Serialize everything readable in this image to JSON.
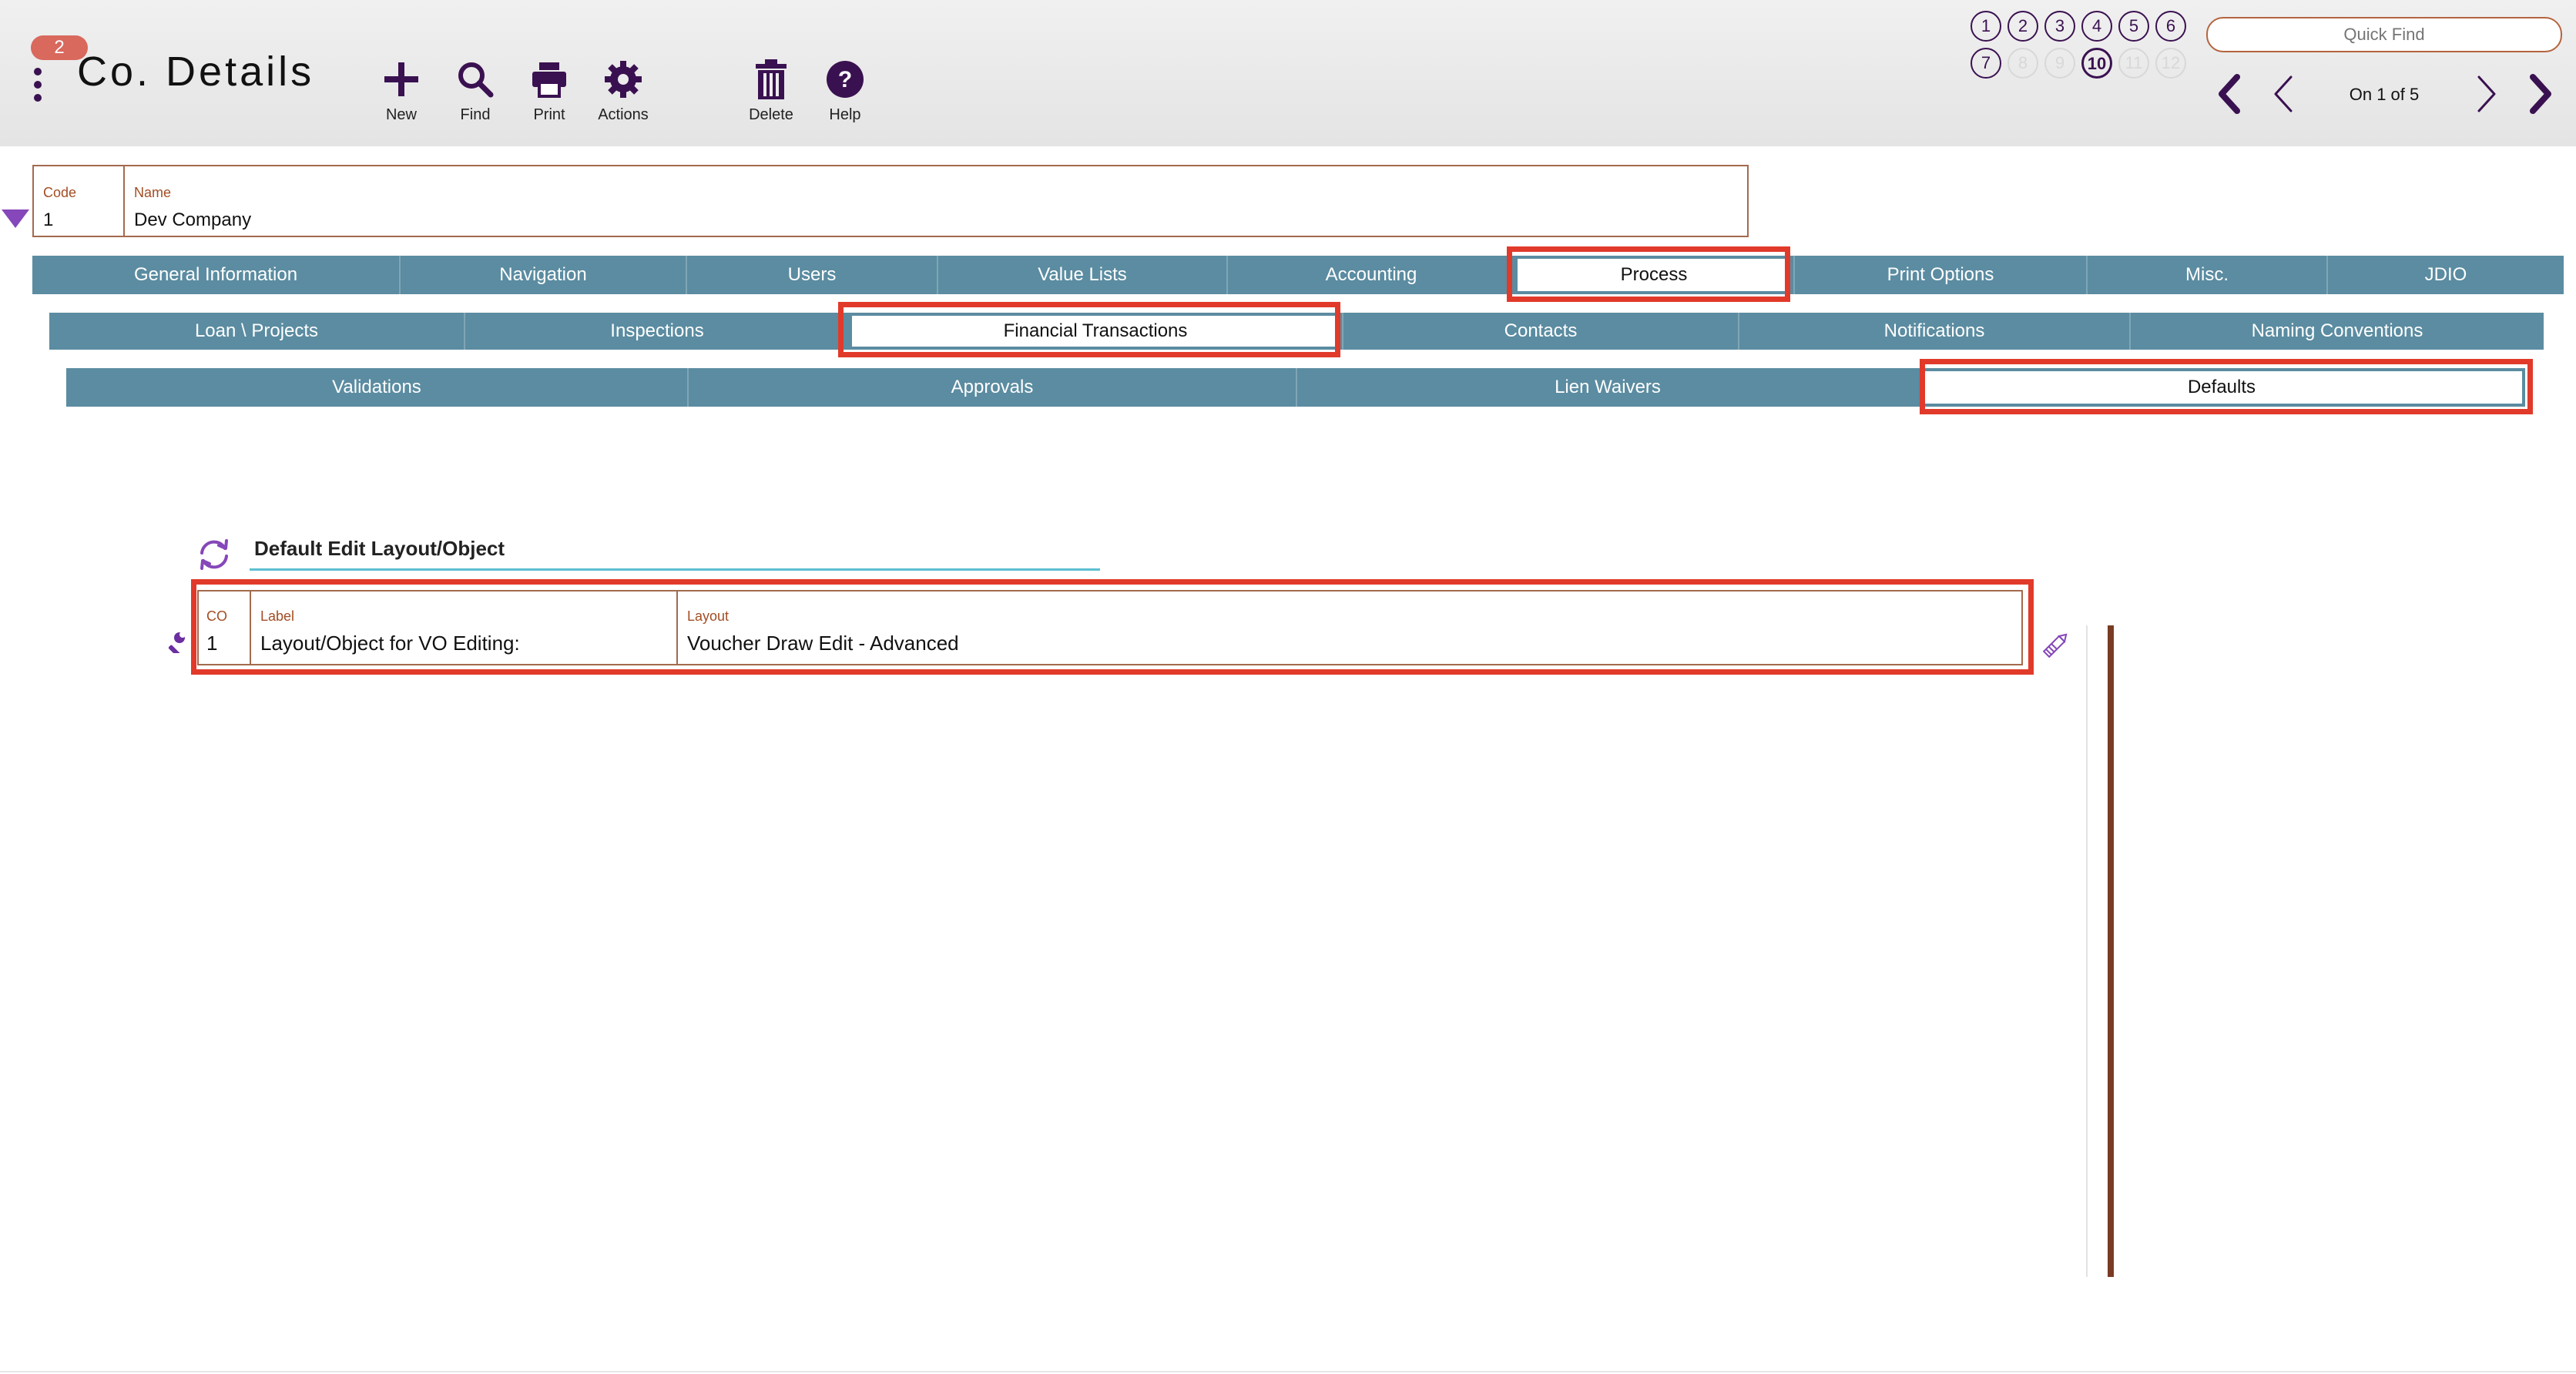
{
  "header": {
    "badge_count": "2",
    "title": "Co. Details",
    "toolbar": {
      "new_label": "New",
      "find_label": "Find",
      "print_label": "Print",
      "actions_label": "Actions",
      "delete_label": "Delete",
      "help_label": "Help"
    },
    "layout_numbers": [
      "1",
      "2",
      "3",
      "4",
      "5",
      "6",
      "7",
      "8",
      "9",
      "10",
      "11",
      "12"
    ],
    "current_layout": "10",
    "disabled_layouts": [
      "8",
      "9",
      "11",
      "12"
    ],
    "quick_find_placeholder": "Quick Find",
    "record_position": "On 1 of 5"
  },
  "record": {
    "code_caption": "Code",
    "code_value": "1",
    "name_caption": "Name",
    "name_value": "Dev Company"
  },
  "tabs_level1": {
    "items": [
      "General Information",
      "Navigation",
      "Users",
      "Value Lists",
      "Accounting",
      "Process",
      "Print Options",
      "Misc.",
      "JDIO"
    ],
    "active": "Process"
  },
  "tabs_level2": {
    "items": [
      "Loan \\ Projects",
      "Inspections",
      "Financial Transactions",
      "Contacts",
      "Notifications",
      "Naming Conventions"
    ],
    "active": "Financial Transactions"
  },
  "tabs_level3": {
    "items": [
      "Validations",
      "Approvals",
      "Lien Waivers",
      "Defaults"
    ],
    "active": "Defaults"
  },
  "section": {
    "title": "Default Edit Layout/Object",
    "row": {
      "co_caption": "CO",
      "co_value": "1",
      "label_caption": "Label",
      "label_value": "Layout/Object for VO Editing:",
      "layout_caption": "Layout",
      "layout_value": "Voucher Draw Edit - Advanced"
    }
  },
  "colors": {
    "tab_bg": "#5b8ca1",
    "accent_purple": "#3a1150",
    "highlight_red": "#e13a2a",
    "field_border": "#a36a4d",
    "caption_text": "#a34d23",
    "badge": "#d9685d",
    "underline": "#5cc0d2"
  }
}
